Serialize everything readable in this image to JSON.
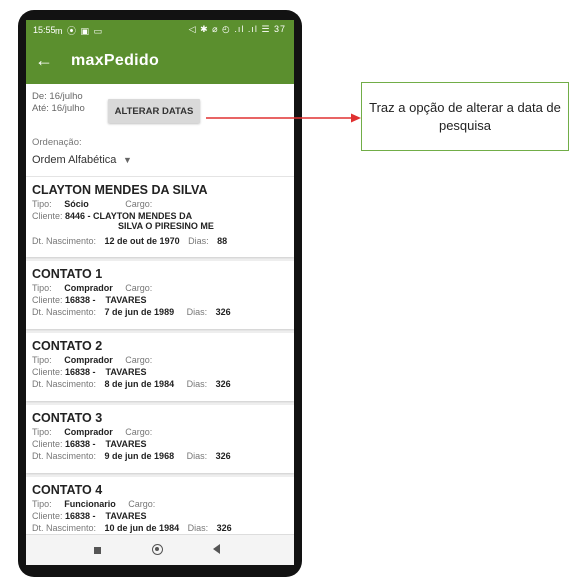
{
  "status_bar": {
    "time": "15:55",
    "left_icons": "m ⦿ ▣ ▭",
    "right_icons": "◁ ✱ ⌀ ◴ .ıl .ıl ☰ 37"
  },
  "app_bar": {
    "back_icon": "arrow-left",
    "title": "maxPedido"
  },
  "filter": {
    "from_date": "De: 16/julho",
    "to_date": "Até: 16/julho",
    "alter_button": "ALTERAR DATAS",
    "order_label": "Ordenação:",
    "order_value": "Ordem Alfabética"
  },
  "contacts": [
    {
      "name": "CLAYTON MENDES DA SILVA",
      "tipo_label": "Tipo:",
      "tipo": "Sócio",
      "cargo_label": "Cargo:",
      "cliente_label": "Cliente:",
      "cliente": "8446 - CLAYTON MENDES DA",
      "cliente_line2": "SILVA O PIRESINO ME",
      "nasc_label": "Dt. Nascimento:",
      "nasc": "12 de out de 1970",
      "dias_label": "Dias:",
      "dias": "88"
    },
    {
      "name": "CONTATO 1",
      "tipo_label": "Tipo:",
      "tipo": "Comprador",
      "cargo_label": "Cargo:",
      "cliente_label": "Cliente:",
      "cliente": "16838 -    TAVARES",
      "nasc_label": "Dt. Nascimento:",
      "nasc": "7 de jun de 1989",
      "dias_label": "Dias:",
      "dias": "326"
    },
    {
      "name": "CONTATO 2",
      "tipo_label": "Tipo:",
      "tipo": "Comprador",
      "cargo_label": "Cargo:",
      "cliente_label": "Cliente:",
      "cliente": "16838 -    TAVARES",
      "nasc_label": "Dt. Nascimento:",
      "nasc": "8 de jun de 1984",
      "dias_label": "Dias:",
      "dias": "326"
    },
    {
      "name": "CONTATO 3",
      "tipo_label": "Tipo:",
      "tipo": "Comprador",
      "cargo_label": "Cargo:",
      "cliente_label": "Cliente:",
      "cliente": "16838 -    TAVARES",
      "nasc_label": "Dt. Nascimento:",
      "nasc": "9 de jun de 1968",
      "dias_label": "Dias:",
      "dias": "326"
    },
    {
      "name": "CONTATO 4",
      "tipo_label": "Tipo:",
      "tipo": "Funcionario",
      "cargo_label": "Cargo:",
      "cliente_label": "Cliente:",
      "cliente": "16838 -    TAVARES",
      "nasc_label": "Dt. Nascimento:",
      "nasc": "10 de jun de 1984",
      "dias_label": "Dias:",
      "dias": "326"
    }
  ],
  "callout": {
    "text": "Traz a opção de alterar a data de pesquisa"
  },
  "colors": {
    "app_bar": "#5b8f2e",
    "callout_border": "#71ad47",
    "arrow": "#e03030"
  }
}
